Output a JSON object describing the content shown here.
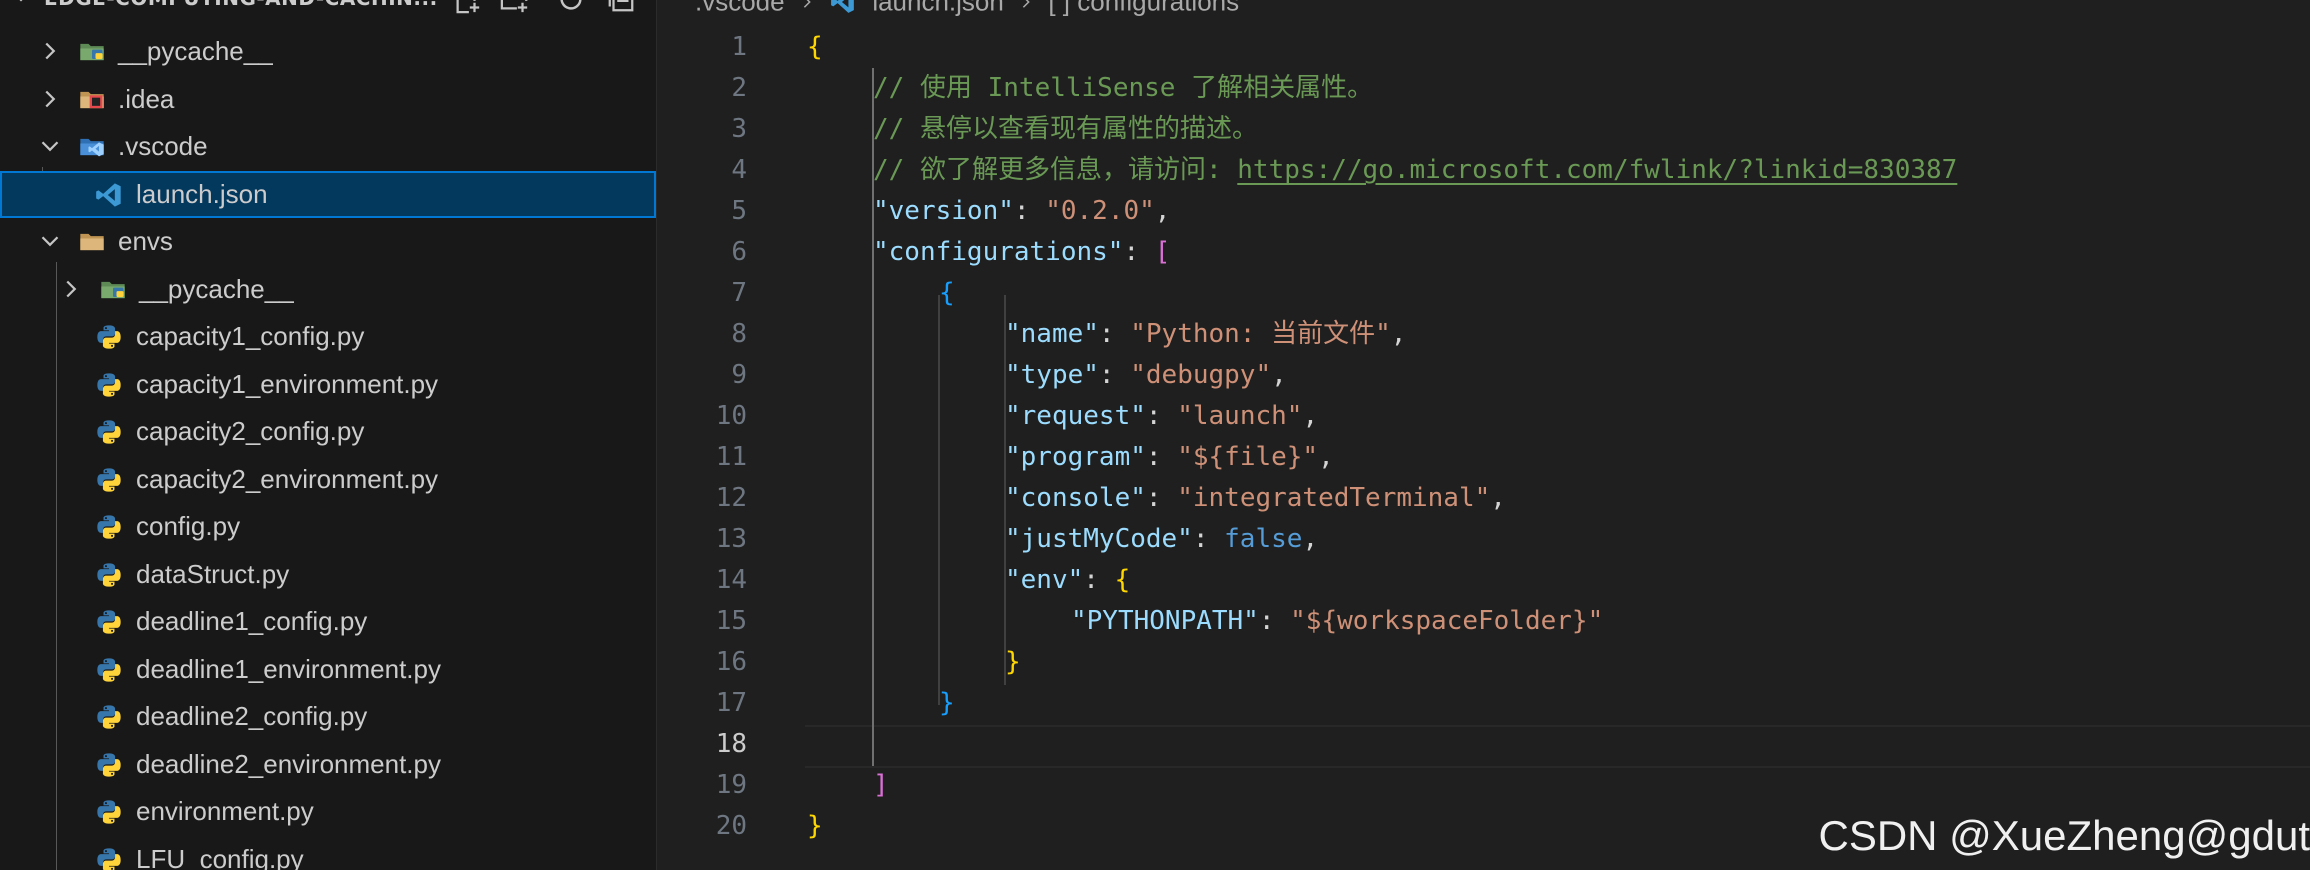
{
  "explorer": {
    "project_title": "EDGE-COMPUTING-AND-CACHIN...",
    "actions": [
      {
        "icon": "new-file-icon"
      },
      {
        "icon": "new-folder-icon"
      },
      {
        "icon": "refresh-icon"
      },
      {
        "icon": "collapse-all-icon"
      }
    ],
    "tree": [
      {
        "label": "__pycache__",
        "type": "folder",
        "icon": "pycache-folder-icon",
        "expanded": false
      },
      {
        "label": ".idea",
        "type": "folder",
        "icon": "idea-folder-icon",
        "expanded": false
      },
      {
        "label": ".vscode",
        "type": "folder",
        "icon": "vscode-folder-icon",
        "expanded": true
      },
      {
        "label": "launch.json",
        "type": "file",
        "icon": "vscode-file-icon",
        "selected": true
      },
      {
        "label": "envs",
        "type": "folder",
        "icon": "folder-icon",
        "expanded": true
      },
      {
        "label": "__pycache__",
        "type": "folder",
        "icon": "pycache-folder-icon",
        "expanded": false
      },
      {
        "label": "capacity1_config.py",
        "type": "file",
        "icon": "python-icon"
      },
      {
        "label": "capacity1_environment.py",
        "type": "file",
        "icon": "python-icon"
      },
      {
        "label": "capacity2_config.py",
        "type": "file",
        "icon": "python-icon"
      },
      {
        "label": "capacity2_environment.py",
        "type": "file",
        "icon": "python-icon"
      },
      {
        "label": "config.py",
        "type": "file",
        "icon": "python-icon"
      },
      {
        "label": "dataStruct.py",
        "type": "file",
        "icon": "python-icon"
      },
      {
        "label": "deadline1_config.py",
        "type": "file",
        "icon": "python-icon"
      },
      {
        "label": "deadline1_environment.py",
        "type": "file",
        "icon": "python-icon"
      },
      {
        "label": "deadline2_config.py",
        "type": "file",
        "icon": "python-icon"
      },
      {
        "label": "deadline2_environment.py",
        "type": "file",
        "icon": "python-icon"
      },
      {
        "label": "environment.py",
        "type": "file",
        "icon": "python-icon"
      },
      {
        "label": "LFU_config.py",
        "type": "file",
        "icon": "python-icon"
      }
    ]
  },
  "breadcrumb": {
    "folder": ".vscode",
    "file": "launch.json",
    "symbol_icon": "[ ]",
    "symbol": "configurations"
  },
  "editor": {
    "active_line": "18",
    "lines": [
      {
        "n": "1"
      },
      {
        "n": "2"
      },
      {
        "n": "3"
      },
      {
        "n": "4"
      },
      {
        "n": "5"
      },
      {
        "n": "6"
      },
      {
        "n": "7"
      },
      {
        "n": "8"
      },
      {
        "n": "9"
      },
      {
        "n": "10"
      },
      {
        "n": "11"
      },
      {
        "n": "12"
      },
      {
        "n": "13"
      },
      {
        "n": "14"
      },
      {
        "n": "15"
      },
      {
        "n": "16"
      },
      {
        "n": "17"
      },
      {
        "n": "18"
      },
      {
        "n": "19"
      },
      {
        "n": "20"
      }
    ],
    "code": {
      "l1_open": "{",
      "l2_comment": "// 使用 IntelliSense 了解相关属性。",
      "l3_comment": "// 悬停以查看现有属性的描述。",
      "l4_comment": "// 欲了解更多信息，请访问: ",
      "l4_link": "https://go.microsoft.com/fwlink/?linkid=830387",
      "l5_key": "\"version\"",
      "l5_val": "\"0.2.0\"",
      "l6_key": "\"configurations\"",
      "l6_bracket": "[",
      "l7_open": "{",
      "l8_key": "\"name\"",
      "l8_val": "\"Python: 当前文件\"",
      "l9_key": "\"type\"",
      "l9_val": "\"debugpy\"",
      "l10_key": "\"request\"",
      "l10_val": "\"launch\"",
      "l11_key": "\"program\"",
      "l11_val": "\"${file}\"",
      "l12_key": "\"console\"",
      "l12_val": "\"integratedTerminal\"",
      "l13_key": "\"justMyCode\"",
      "l13_val": "false",
      "l14_key": "\"env\"",
      "l14_open": "{",
      "l15_key": "\"PYTHONPATH\"",
      "l15_val": "\"${workspaceFolder}\"",
      "l16_close": "}",
      "l17_close": "}",
      "l19_bracket": "]",
      "l20_close": "}"
    }
  },
  "watermark": "CSDN @XueZheng@gdut"
}
